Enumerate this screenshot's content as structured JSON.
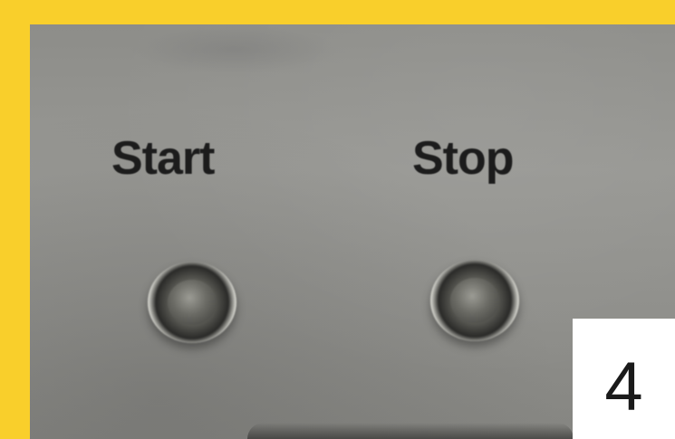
{
  "photo": {
    "labels": {
      "start": "Start",
      "stop": "Stop"
    },
    "buttons": [
      "start",
      "stop"
    ],
    "badge_number": "4",
    "colors": {
      "frame": "#f9cf2b",
      "panel": "#92928e",
      "label_text": "#1c1c1c",
      "badge_background": "#ffffff"
    }
  }
}
